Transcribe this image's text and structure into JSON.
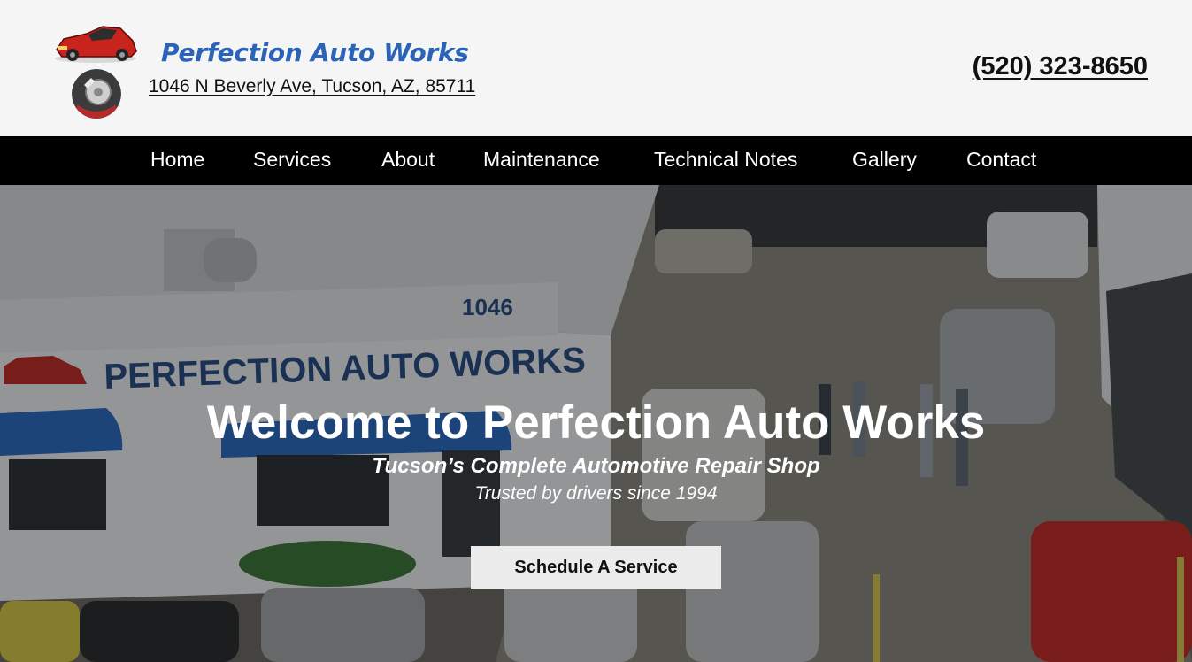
{
  "header": {
    "brand": "Perfection Auto Works",
    "address": "1046 N Beverly Ave, Tucson, AZ, 85711",
    "phone": "(520) 323-8650"
  },
  "nav": {
    "items": [
      "Home",
      "Services",
      "About",
      "Maintenance",
      "Technical Notes",
      "Gallery",
      "Contact"
    ]
  },
  "hero": {
    "building_number": "1046",
    "building_sign": "PERFECTION AUTO WORKS",
    "title": "Welcome to Perfection Auto Works",
    "subtitle": "Tucson’s Complete Automotive Repair Shop",
    "tagline": "Trusted by drivers since 1994",
    "cta_label": "Schedule A Service"
  },
  "colors": {
    "brand": "#2a63b8",
    "nav_bg": "#000000",
    "header_bg": "#f5f5f5"
  }
}
